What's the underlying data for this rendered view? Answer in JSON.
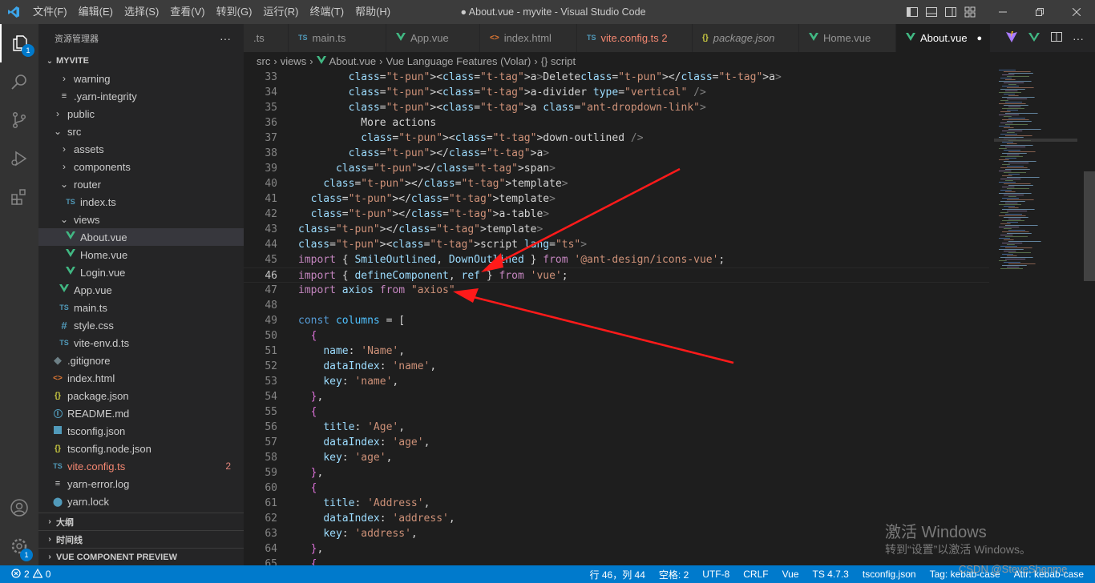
{
  "titlebar": {
    "menus": [
      "文件(F)",
      "编辑(E)",
      "选择(S)",
      "查看(V)",
      "转到(G)",
      "运行(R)",
      "终端(T)",
      "帮助(H)"
    ],
    "title": "● About.vue - myvite - Visual Studio Code"
  },
  "activitybar": {
    "explorer_badge": "1",
    "settings_badge": "1"
  },
  "sidebar": {
    "header": "资源管理器",
    "more": "···",
    "project": "MYVITE",
    "tree": [
      {
        "label": "warning",
        "icon": "chevron-right"
      },
      {
        "label": ".yarn-integrity",
        "icon": "lines"
      },
      {
        "label": "public",
        "icon": "chevron-right"
      },
      {
        "label": "src",
        "icon": "chevron-down"
      },
      {
        "label": "assets",
        "icon": "chevron-right"
      },
      {
        "label": "components",
        "icon": "chevron-right"
      },
      {
        "label": "router",
        "icon": "chevron-down"
      },
      {
        "label": "index.ts",
        "icon": "TS"
      },
      {
        "label": "views",
        "icon": "chevron-down"
      },
      {
        "label": "About.vue",
        "icon": "vue"
      },
      {
        "label": "Home.vue",
        "icon": "vue"
      },
      {
        "label": "Login.vue",
        "icon": "vue"
      },
      {
        "label": "App.vue",
        "icon": "vue"
      },
      {
        "label": "main.ts",
        "icon": "TS"
      },
      {
        "label": "style.css",
        "icon": "#"
      },
      {
        "label": "vite-env.d.ts",
        "icon": "TS"
      },
      {
        "label": ".gitignore",
        "icon": "git"
      },
      {
        "label": "index.html",
        "icon": "<>"
      },
      {
        "label": "package.json",
        "icon": "{}"
      },
      {
        "label": "README.md",
        "icon": "i"
      },
      {
        "label": "tsconfig.json",
        "icon": "ts-box"
      },
      {
        "label": "tsconfig.node.json",
        "icon": "{}"
      },
      {
        "label": "vite.config.ts",
        "icon": "TS",
        "count": "2"
      },
      {
        "label": "yarn-error.log",
        "icon": "lines"
      },
      {
        "label": "yarn.lock",
        "icon": "yarn"
      }
    ],
    "sections": [
      "大纲",
      "时间线",
      "VUE COMPONENT PREVIEW"
    ]
  },
  "tabs": [
    {
      "label": ".ts",
      "icon": ""
    },
    {
      "label": "main.ts",
      "icon": "TS"
    },
    {
      "label": "App.vue",
      "icon": "vue"
    },
    {
      "label": "index.html",
      "icon": "<>"
    },
    {
      "label": "vite.config.ts 2",
      "icon": "TS"
    },
    {
      "label": "package.json",
      "icon": "{}"
    },
    {
      "label": "Home.vue",
      "icon": "vue"
    },
    {
      "label": "About.vue",
      "icon": "vue",
      "dirty": "●"
    }
  ],
  "breadcrumb": [
    "src",
    "views",
    "About.vue",
    "Vue Language Features (Volar)",
    "{} script"
  ],
  "editor": {
    "current_line": 46,
    "lines": [
      {
        "n": "33",
        "text": "        <a>Delete</a>"
      },
      {
        "n": "34",
        "text": "        <a-divider type=\"vertical\" />"
      },
      {
        "n": "35",
        "text": "        <a class=\"ant-dropdown-link\">"
      },
      {
        "n": "36",
        "text": "          More actions"
      },
      {
        "n": "37",
        "text": "          <down-outlined />"
      },
      {
        "n": "38",
        "text": "        </a>"
      },
      {
        "n": "39",
        "text": "      </span>"
      },
      {
        "n": "40",
        "text": "    </template>"
      },
      {
        "n": "41",
        "text": "  </template>"
      },
      {
        "n": "42",
        "text": "  </a-table>"
      },
      {
        "n": "43",
        "text": "</template>"
      },
      {
        "n": "44",
        "text": "<script lang=\"ts\">"
      },
      {
        "n": "45",
        "text": "import { SmileOutlined, DownOutlined } from '@ant-design/icons-vue';"
      },
      {
        "n": "46",
        "text": "import { defineComponent, ref } from 'vue';"
      },
      {
        "n": "47",
        "text": "import axios from \"axios\""
      },
      {
        "n": "48",
        "text": ""
      },
      {
        "n": "49",
        "text": "const columns = ["
      },
      {
        "n": "50",
        "text": "  {"
      },
      {
        "n": "51",
        "text": "    name: 'Name',"
      },
      {
        "n": "52",
        "text": "    dataIndex: 'name',"
      },
      {
        "n": "53",
        "text": "    key: 'name',"
      },
      {
        "n": "54",
        "text": "  },"
      },
      {
        "n": "55",
        "text": "  {"
      },
      {
        "n": "56",
        "text": "    title: 'Age',"
      },
      {
        "n": "57",
        "text": "    dataIndex: 'age',"
      },
      {
        "n": "58",
        "text": "    key: 'age',"
      },
      {
        "n": "59",
        "text": "  },"
      },
      {
        "n": "60",
        "text": "  {"
      },
      {
        "n": "61",
        "text": "    title: 'Address',"
      },
      {
        "n": "62",
        "text": "    dataIndex: 'address',"
      },
      {
        "n": "63",
        "text": "    key: 'address',"
      },
      {
        "n": "64",
        "text": "  },"
      },
      {
        "n": "65",
        "text": "  {"
      }
    ]
  },
  "overlay": {
    "windows_activate": "激活 Windows",
    "windows_activate_hint": "转到“设置”以激活 Windows。",
    "csdn": "CSDN @SteveShenme"
  },
  "statusbar": {
    "errors": "2",
    "warnings": "0",
    "position": "行 46，列 44",
    "spaces": "空格: 2",
    "encoding": "UTF-8",
    "eol": "CRLF",
    "language": "Vue",
    "ts_version": "TS 4.7.3",
    "tsconfig": "tsconfig.json",
    "tag_case": "Tag: kebab-case",
    "attr_case": "Attr: kebab-case"
  },
  "colors": {
    "accent": "#007acc",
    "vue_green": "#41b883",
    "ts_blue": "#519aba",
    "arrow_red": "#ff2020"
  }
}
